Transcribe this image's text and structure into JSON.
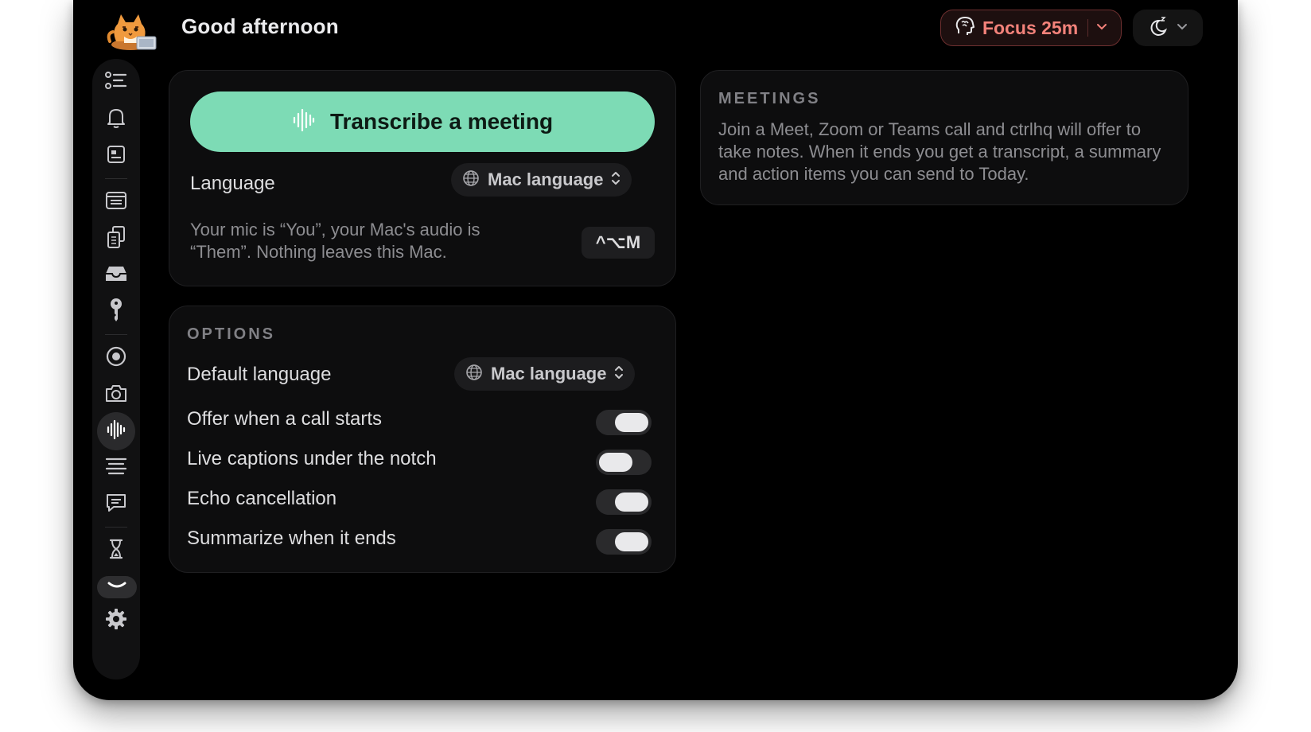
{
  "header": {
    "greeting": "Good afternoon",
    "focus_label": "Focus 25m",
    "focus_color": "#f3827a"
  },
  "sidebar": {
    "items": [
      {
        "name": "tasks",
        "icon": "checklist-icon"
      },
      {
        "name": "reminders",
        "icon": "bell-icon"
      },
      {
        "name": "notes",
        "icon": "note-card-icon"
      },
      {
        "name": "reader",
        "icon": "document-lines-icon"
      },
      {
        "name": "clipboard",
        "icon": "copy-documents-icon"
      },
      {
        "name": "inbox",
        "icon": "inbox-tray-icon"
      },
      {
        "name": "passwords",
        "icon": "key-icon"
      },
      {
        "name": "record",
        "icon": "record-icon"
      },
      {
        "name": "screenshot",
        "icon": "camera-icon"
      },
      {
        "name": "transcribe",
        "icon": "waveform-icon",
        "active": true
      },
      {
        "name": "text",
        "icon": "text-align-icon"
      },
      {
        "name": "chat",
        "icon": "chat-bubble-icon"
      },
      {
        "name": "timer",
        "icon": "hourglass-icon"
      },
      {
        "name": "notch",
        "icon": "notch-smile-icon"
      },
      {
        "name": "settings",
        "icon": "gear-icon"
      }
    ]
  },
  "transcribe": {
    "button_label": "Transcribe a meeting",
    "language_label": "Language",
    "language_value": "Mac language",
    "note": "Your mic is “You”, your Mac's audio is “Them”. Nothing leaves this Mac.",
    "shortcut": "^⌥M"
  },
  "options": {
    "title": "OPTIONS",
    "default_language_label": "Default language",
    "default_language_value": "Mac language",
    "toggles": [
      {
        "label": "Offer when a call starts",
        "on": true
      },
      {
        "label": "Live captions under the notch",
        "on": false
      },
      {
        "label": "Echo cancellation",
        "on": true
      },
      {
        "label": "Summarize when it ends",
        "on": true
      }
    ]
  },
  "meetings": {
    "title": "MEETINGS",
    "description": "Join a Meet, Zoom or Teams call and ctrlhq will offer to take notes. When it ends you get a transcript, a summary and action items you can send to Today."
  },
  "colors": {
    "accent_green": "#7ddbb5",
    "focus_border": "#6d2f2f"
  }
}
